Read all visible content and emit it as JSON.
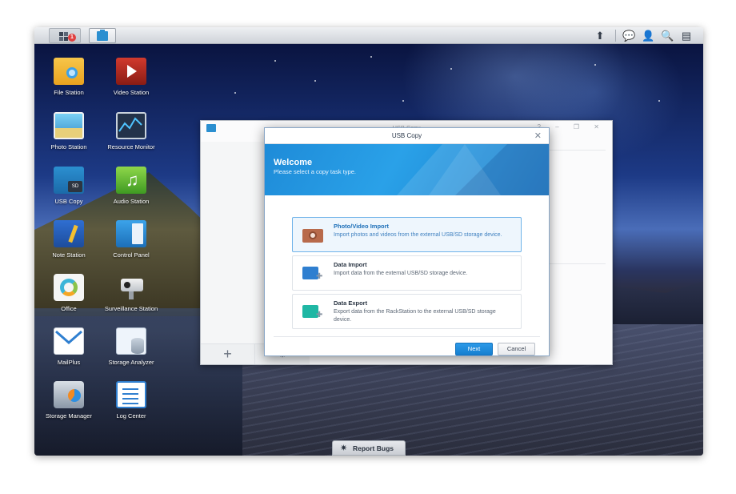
{
  "taskbar": {
    "main_menu_badge": "1",
    "icons": [
      "upload-icon",
      "chat-icon",
      "user-icon",
      "search-icon",
      "widgets-icon"
    ]
  },
  "desktop_icons": [
    {
      "label": "File Station"
    },
    {
      "label": "Video Station"
    },
    {
      "label": "Photo Station"
    },
    {
      "label": "Resource Monitor"
    },
    {
      "label": "USB Copy"
    },
    {
      "label": "Audio Station"
    },
    {
      "label": "Note Station"
    },
    {
      "label": "Control Panel"
    },
    {
      "label": "Office"
    },
    {
      "label": "Surveillance Station"
    },
    {
      "label": "MailPlus"
    },
    {
      "label": "Storage Analyzer"
    },
    {
      "label": "Storage Manager"
    },
    {
      "label": "Log Center"
    }
  ],
  "background_window": {
    "title": "USB Copy",
    "add_label": "+",
    "controls": "? – ❐ ✕"
  },
  "dialog": {
    "title": "USB Copy",
    "heading": "Welcome",
    "subheading": "Please select a copy task type.",
    "options": [
      {
        "title": "Photo/Video Import",
        "description": "Import photos and videos from the external USB/SD storage device.",
        "selected": true
      },
      {
        "title": "Data Import",
        "description": "Import data from the external USB/SD storage device.",
        "selected": false
      },
      {
        "title": "Data Export",
        "description": "Export data from the RackStation to the external USB/SD storage device.",
        "selected": false
      }
    ],
    "next_label": "Next",
    "cancel_label": "Cancel"
  },
  "report_bugs": {
    "label": "Report Bugs"
  },
  "colors": {
    "accent": "#1e8bd8",
    "selected_border": "#6fb3e9",
    "badge": "#e04040"
  }
}
